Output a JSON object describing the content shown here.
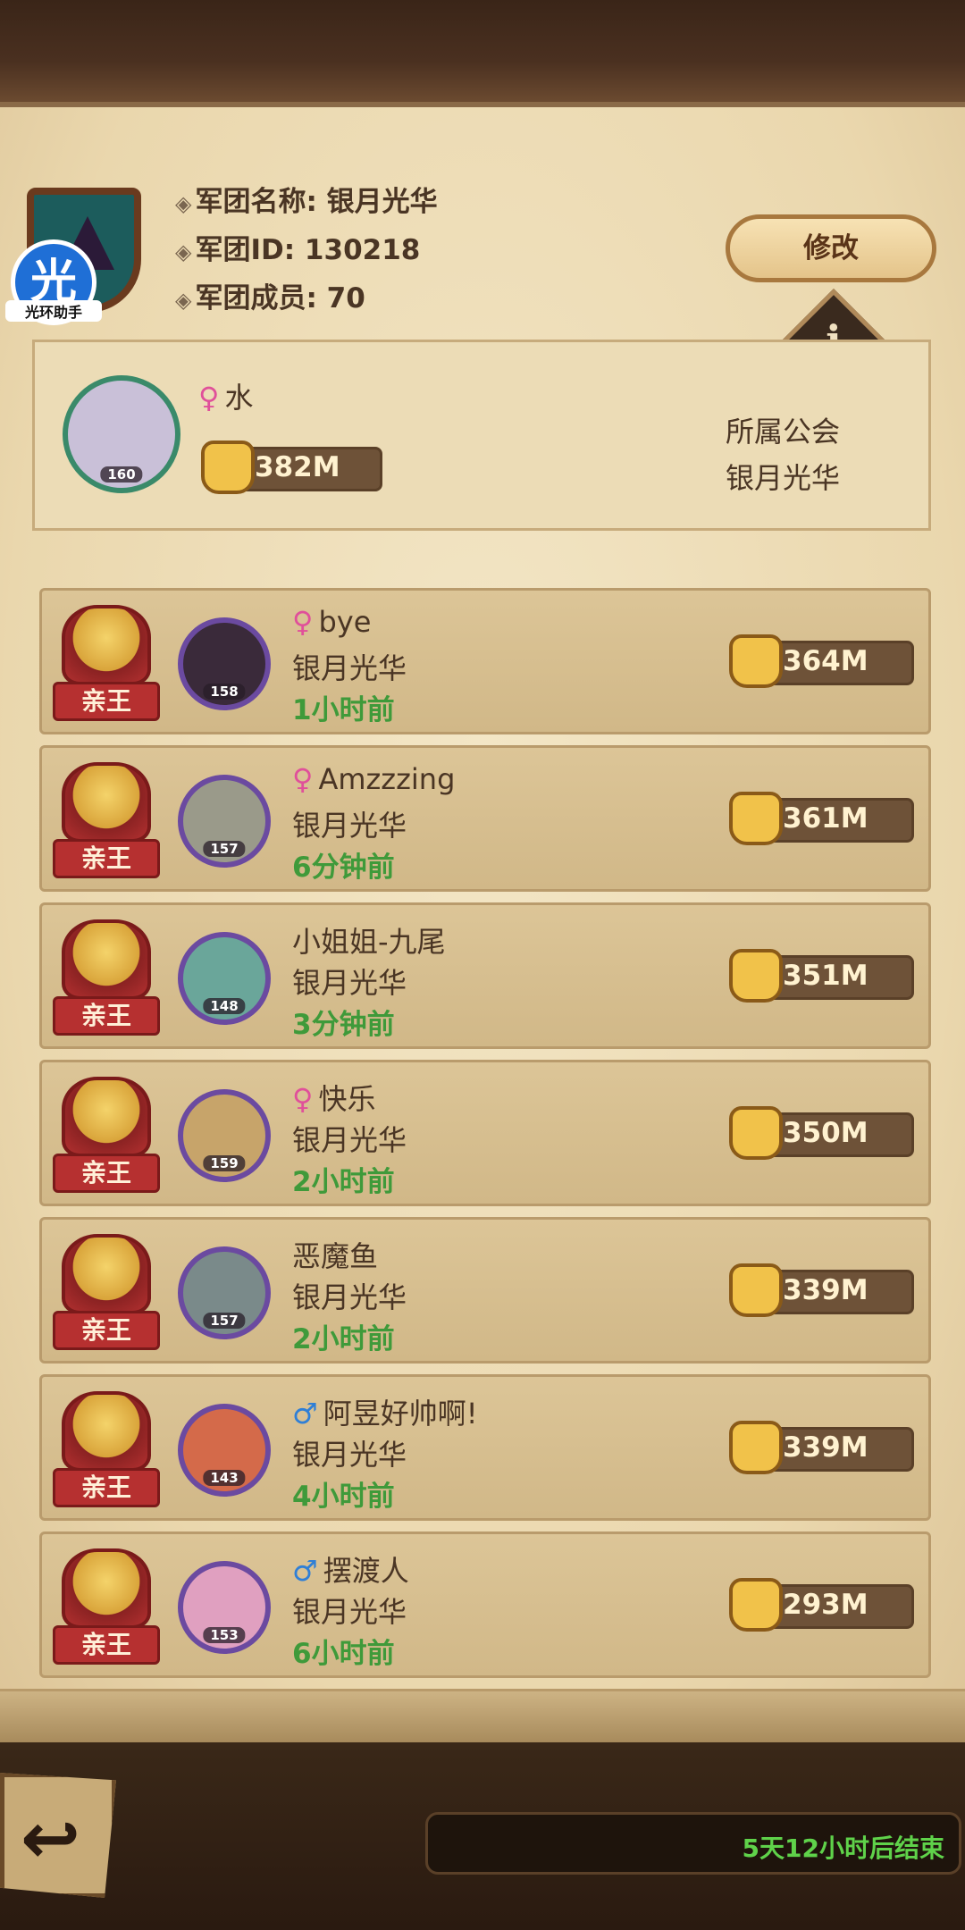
{
  "header": {
    "guild_name_line": "军团名称: 银月光华",
    "guild_id_line": "军团ID: 130218",
    "guild_members_line": "军团成员: 70",
    "edit_label": "修改",
    "info_label": "i",
    "watermark_char": "光",
    "watermark_text": "光环助手"
  },
  "self": {
    "gender": "♀",
    "name": "水",
    "level": "160",
    "power": "382M",
    "guild_title": "所属公会",
    "guild_name": "银月光华"
  },
  "members": [
    {
      "rank": "亲王",
      "gender": "♀",
      "gender_type": "female",
      "name": "bye",
      "guild": "银月光华",
      "time": "1小时前",
      "level": "158",
      "power": "364M",
      "avatar_color": "#3a2a3a"
    },
    {
      "rank": "亲王",
      "gender": "♀",
      "gender_type": "female",
      "name": "Amzzzing",
      "guild": "银月光华",
      "time": "6分钟前",
      "level": "157",
      "power": "361M",
      "avatar_color": "#9a9a8a"
    },
    {
      "rank": "亲王",
      "gender": "",
      "gender_type": "none",
      "name": "小姐姐-九尾",
      "guild": "银月光华",
      "time": "3分钟前",
      "level": "148",
      "power": "351M",
      "avatar_color": "#6aa69a"
    },
    {
      "rank": "亲王",
      "gender": "♀",
      "gender_type": "female",
      "name": "快乐",
      "guild": "银月光华",
      "time": "2小时前",
      "level": "159",
      "power": "350M",
      "avatar_color": "#c7a46a"
    },
    {
      "rank": "亲王",
      "gender": "",
      "gender_type": "none",
      "name": "恶魔鱼",
      "guild": "银月光华",
      "time": "2小时前",
      "level": "157",
      "power": "339M",
      "avatar_color": "#7a8a8a"
    },
    {
      "rank": "亲王",
      "gender": "♂",
      "gender_type": "male",
      "name": "阿昱好帅啊!",
      "guild": "银月光华",
      "time": "4小时前",
      "level": "143",
      "power": "339M",
      "avatar_color": "#d46a4a"
    },
    {
      "rank": "亲王",
      "gender": "♂",
      "gender_type": "male",
      "name": "摆渡人",
      "guild": "银月光华",
      "time": "6小时前",
      "level": "153",
      "power": "293M",
      "avatar_color": "#e0a0c0"
    }
  ],
  "footer": {
    "back_label": "↩",
    "countdown": "5天12小时后结束"
  }
}
